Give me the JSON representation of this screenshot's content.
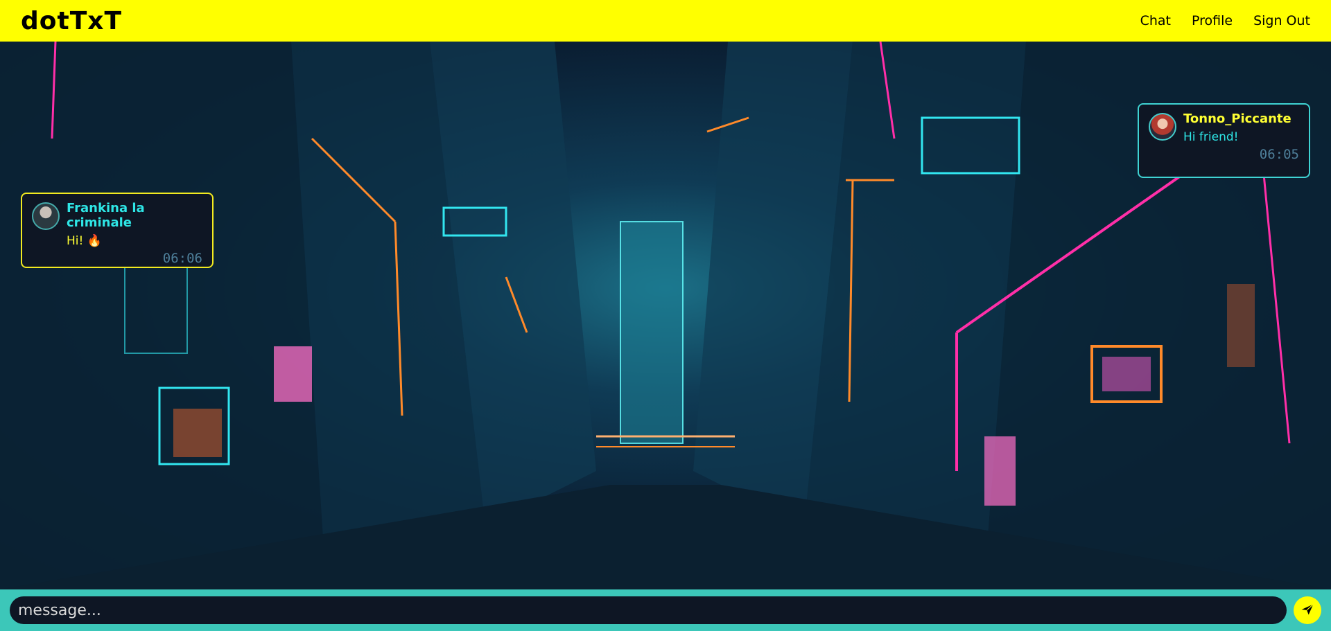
{
  "header": {
    "logo": "dotTxT",
    "nav": {
      "chat": "Chat",
      "profile": "Profile",
      "sign_out": "Sign Out"
    }
  },
  "messages": [
    {
      "author": "Frankina la criminale",
      "text": "Hi! 🔥",
      "time": "06:06",
      "side": "left"
    },
    {
      "author": "Tonno_Piccante",
      "text": "Hi friend!",
      "time": "06:05",
      "side": "right"
    }
  ],
  "composer": {
    "placeholder": "message..."
  },
  "icons": {
    "send": "send-arrow-icon"
  },
  "colors": {
    "header_bg": "#ffff00",
    "footer_bg": "#3cc7b9",
    "accent_cyan": "#2ee6e6",
    "accent_yellow": "#ffff33"
  }
}
